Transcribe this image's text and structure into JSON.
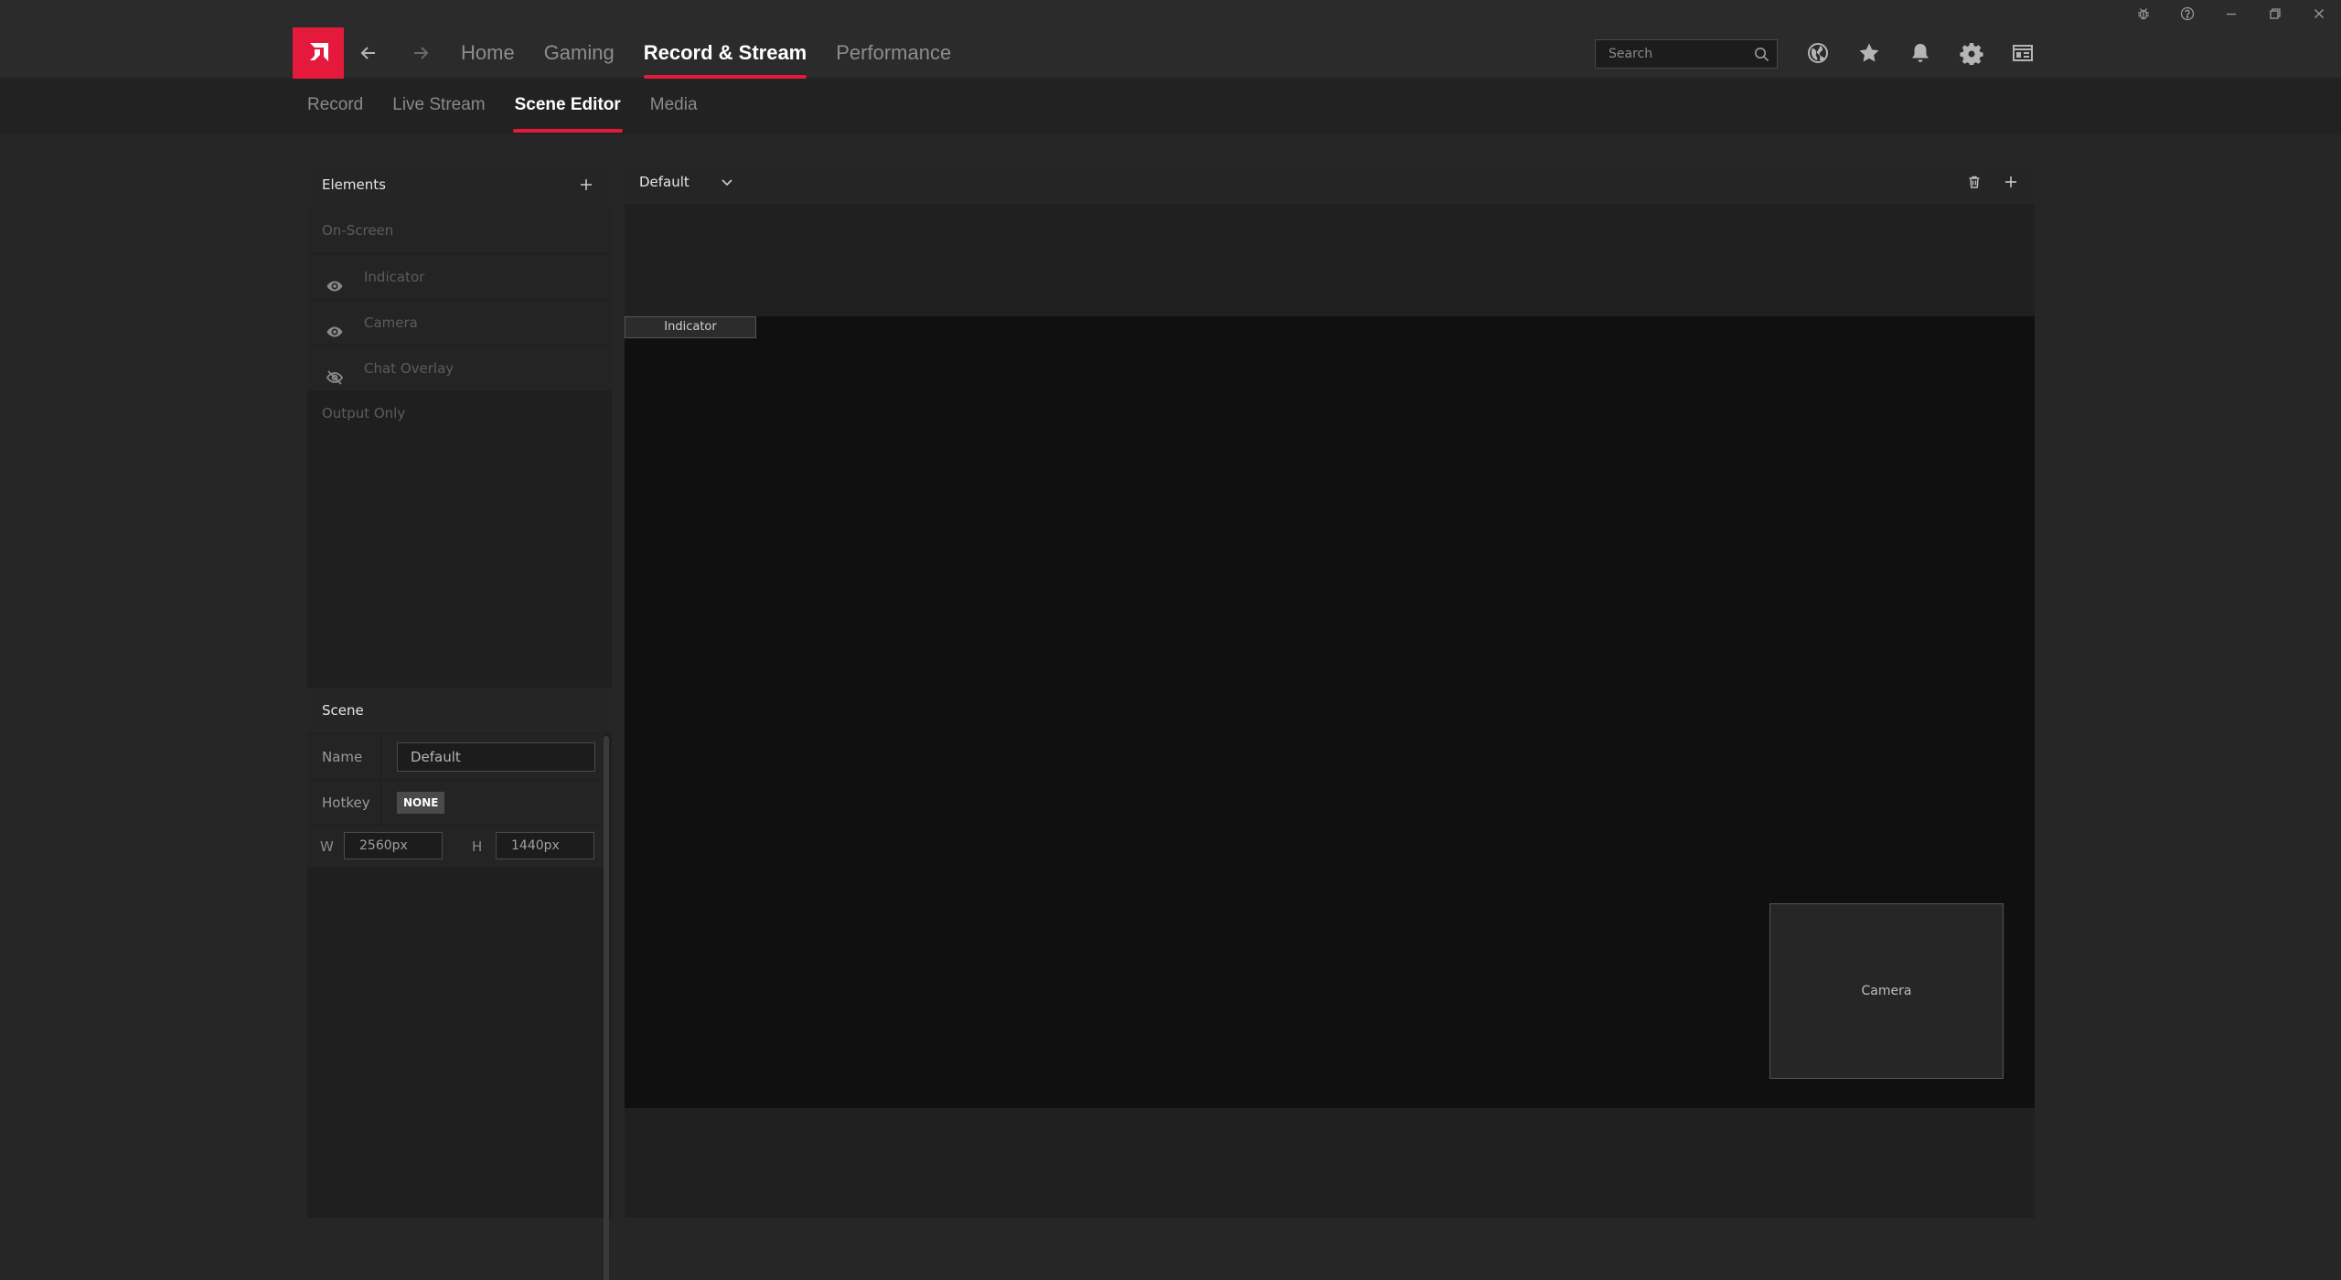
{
  "app": {
    "nav": [
      "Home",
      "Gaming",
      "Record & Stream",
      "Performance"
    ],
    "active_nav": "Record & Stream",
    "search_placeholder": "Search",
    "tool_icons": [
      "globe-icon",
      "star-icon",
      "bell-icon",
      "gear-icon",
      "profile-card-icon"
    ],
    "window_controls": [
      "bug-icon",
      "help-icon",
      "minimize-icon",
      "restore-icon",
      "close-icon"
    ]
  },
  "subnav": {
    "items": [
      "Record",
      "Live Stream",
      "Scene Editor",
      "Media"
    ],
    "active": "Scene Editor"
  },
  "elements": {
    "title": "Elements",
    "on_screen_label": "On-Screen",
    "items": [
      {
        "label": "Indicator",
        "visible": true
      },
      {
        "label": "Camera",
        "visible": true
      },
      {
        "label": "Chat Overlay",
        "visible": false
      }
    ],
    "output_only_label": "Output Only"
  },
  "scene": {
    "title": "Scene",
    "name_label": "Name",
    "name_value": "Default",
    "hotkey_label": "Hotkey",
    "hotkey_value": "NONE",
    "w_label": "W",
    "w_value": "2560px",
    "h_label": "H",
    "h_value": "1440px"
  },
  "editor": {
    "selected_scene": "Default",
    "canvas_items": {
      "indicator": "Indicator",
      "camera": "Camera"
    }
  },
  "colors": {
    "accent": "#e4193c",
    "background": "#262626",
    "canvas": "#101010"
  }
}
